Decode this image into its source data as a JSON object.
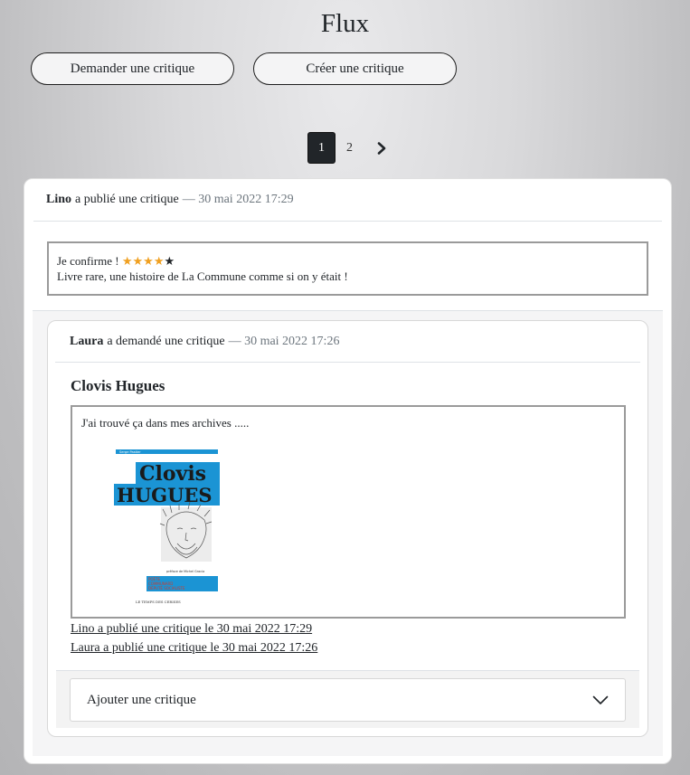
{
  "page": {
    "title": "Flux"
  },
  "toolbar": {
    "request_label": "Demander une critique",
    "create_label": "Créer une critique"
  },
  "pagination": {
    "pages": [
      "1",
      "2"
    ],
    "current": "1",
    "next_icon": "chevron-right-icon"
  },
  "review_post": {
    "author": "Lino",
    "action": "a publié une critique",
    "date": "— 30 mai 2022 17:29",
    "headline": "Je confirme !",
    "rating": 4,
    "rating_max": 5,
    "star_color": "#f0a020",
    "body": "Livre rare, une histoire de La Commune comme si on y était !"
  },
  "ticket_post": {
    "author": "Laura",
    "action": "a demandé une critique",
    "date": "— 30 mai 2022 17:26",
    "title": "Clovis Hugues",
    "description": "J'ai trouvé ça dans mes archives .....",
    "cover": {
      "author": "Serge Pastier",
      "title_line1": "Clovis",
      "title_line2": "HUGUES",
      "preface": "préface de Michel Gracia",
      "subtitle_line1": "POÈTE",
      "subtitle_line2": "COMMUNARD",
      "subtitle_line3": "DÉPUTÉ SOCIALISTE",
      "publisher": "LE TEMPS DES CERISES",
      "accent_color": "#1b94d4"
    },
    "history_links": [
      "Lino a publié une critique le 30 mai 2022 17:29",
      "Laura a publié une critique le 30 mai 2022 17:26"
    ],
    "add_review_label": "Ajouter une critique",
    "add_review_icon": "chevron-down-icon"
  }
}
